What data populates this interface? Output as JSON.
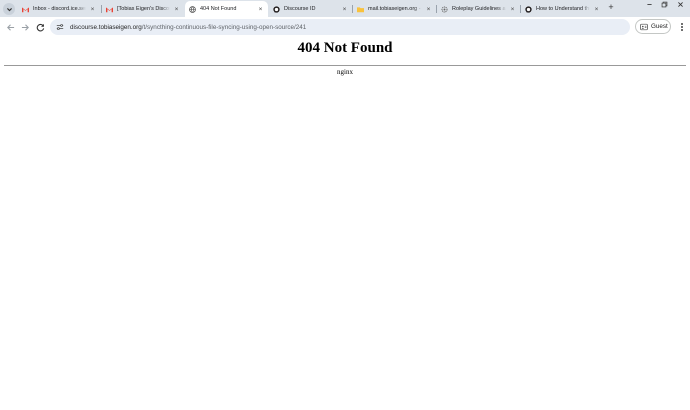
{
  "browser": {
    "tabs": [
      {
        "title": "Inbox - discord.ice.services",
        "favicon": "gmail-icon"
      },
      {
        "title": "[Tobias Eigen's Discourse]",
        "favicon": "gmail-icon"
      },
      {
        "title": "404 Not Found",
        "favicon": "globe-icon",
        "active": true
      },
      {
        "title": "Discourse ID",
        "favicon": "discourse-icon"
      },
      {
        "title": "mail.tobiaseigen.org - ",
        "favicon": "mail-folder-icon"
      },
      {
        "title": "Roleplay Guidelines and",
        "favicon": "gear-favicon-icon"
      },
      {
        "title": "How to Understand the",
        "favicon": "discourse-icon"
      }
    ],
    "url_host": "discourse.tobiaseigen.org",
    "url_path": "/t/syncthing-continuous-file-syncing-using-open-source/241",
    "profile_label": "Guest"
  },
  "page": {
    "heading": "404 Not Found",
    "server": "nginx"
  },
  "colors": {
    "tabstrip": "#dde3ea",
    "omnibox": "#e9eef6",
    "gmail_red": "#ea4335",
    "discourse_dark": "#231f20",
    "folder_yellow": "#f9c23c"
  }
}
